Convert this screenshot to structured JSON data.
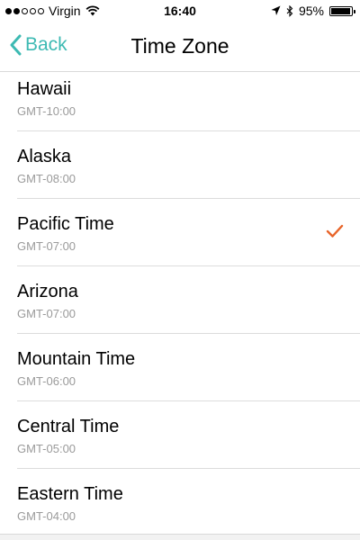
{
  "status_bar": {
    "carrier": "Virgin",
    "signal_filled": 2,
    "signal_total": 5,
    "time": "16:40",
    "battery_text": "95%",
    "battery_level": 0.95,
    "icons": [
      "signal-dots-icon",
      "wifi-icon",
      "location-arrow-icon",
      "bluetooth-icon",
      "battery-icon"
    ]
  },
  "nav": {
    "back_label": "Back",
    "title": "Time Zone"
  },
  "time_zones": [
    {
      "name": "Hawaii",
      "offset": "GMT-10:00",
      "selected": false
    },
    {
      "name": "Alaska",
      "offset": "GMT-08:00",
      "selected": false
    },
    {
      "name": "Pacific Time",
      "offset": "GMT-07:00",
      "selected": true
    },
    {
      "name": "Arizona",
      "offset": "GMT-07:00",
      "selected": false
    },
    {
      "name": "Mountain Time",
      "offset": "GMT-06:00",
      "selected": false
    },
    {
      "name": "Central Time",
      "offset": "GMT-05:00",
      "selected": false
    },
    {
      "name": "Eastern Time",
      "offset": "GMT-04:00",
      "selected": false
    }
  ],
  "colors": {
    "accent": "#3dbab3",
    "checkmark": "#e8652a",
    "secondary_text": "#9a9a9a"
  }
}
